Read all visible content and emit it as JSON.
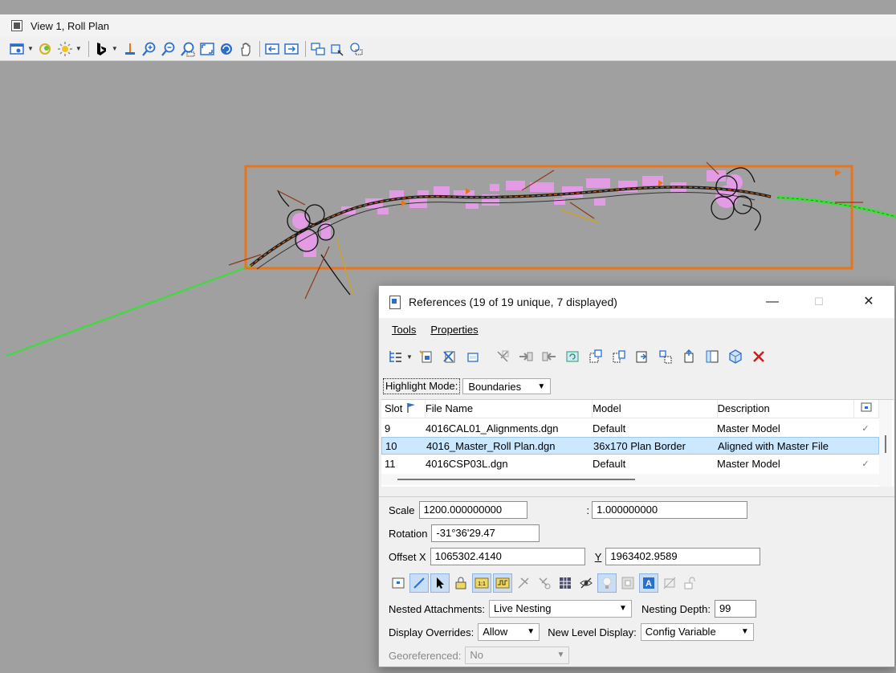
{
  "view": {
    "title": "View 1, Roll Plan"
  },
  "view_toolbar": {
    "icons": [
      "view-attributes-icon",
      "levels-icon",
      "lighting-icon",
      "bing-icon",
      "floor-lamp-icon",
      "zoom-in-icon",
      "zoom-out-icon",
      "window-area-icon",
      "fit-view-icon",
      "rotate-view-icon",
      "pan-view-icon",
      "previous-view-icon",
      "next-view-icon",
      "copy-view-icon",
      "clip-volume-icon",
      "clip-mask-icon"
    ]
  },
  "references": {
    "title": "References (19 of 19 unique, 7 displayed)",
    "window_controls": {
      "minimize": "—",
      "maximize": "☐",
      "close": "✕"
    },
    "menu": {
      "tools": "Tools",
      "properties": "Properties"
    },
    "highlight_mode": {
      "label": "Highlight Mode:",
      "value": "Boundaries"
    },
    "columns": {
      "slot": "Slot",
      "file_name": "File Name",
      "model": "Model",
      "description": "Description"
    },
    "rows": [
      {
        "slot": "9",
        "file_name": "4016CAL01_Alignments.dgn",
        "model": "Default",
        "description": "Master Model",
        "check": "✓"
      },
      {
        "slot": "10",
        "file_name": "4016_Master_Roll Plan.dgn",
        "model": "36x170 Plan Border",
        "description": "Aligned with Master File",
        "check": ""
      },
      {
        "slot": "11",
        "file_name": "4016CSP03L.dgn",
        "model": "Default",
        "description": "Master Model",
        "check": "✓"
      }
    ],
    "props": {
      "scale_label": "Scale",
      "scale_value": "1200.000000000",
      "scale_sep": ":",
      "scale_value2": "1.000000000",
      "rotation_label": "Rotation",
      "rotation_value": "-31°36'29.47",
      "offset_x_label": "Offset X",
      "offset_x_value": "1065302.4140",
      "offset_y_label": "Y",
      "offset_y_value": "1963402.9589",
      "nested_label": "Nested Attachments:",
      "nested_value": "Live Nesting",
      "depth_label": "Nesting Depth:",
      "depth_value": "99",
      "overrides_label": "Display Overrides:",
      "overrides_value": "Allow",
      "newlevel_label": "New Level Display:",
      "newlevel_value": "Config Variable",
      "geo_label": "Georeferenced:",
      "geo_value": "No"
    }
  },
  "colors": {
    "view_bg": "#a0a0a0",
    "border_orange": "#e8741c",
    "alignment_green": "#3ddc3d",
    "parcel_magenta": "#e49be6",
    "selection": "#cce8ff"
  }
}
